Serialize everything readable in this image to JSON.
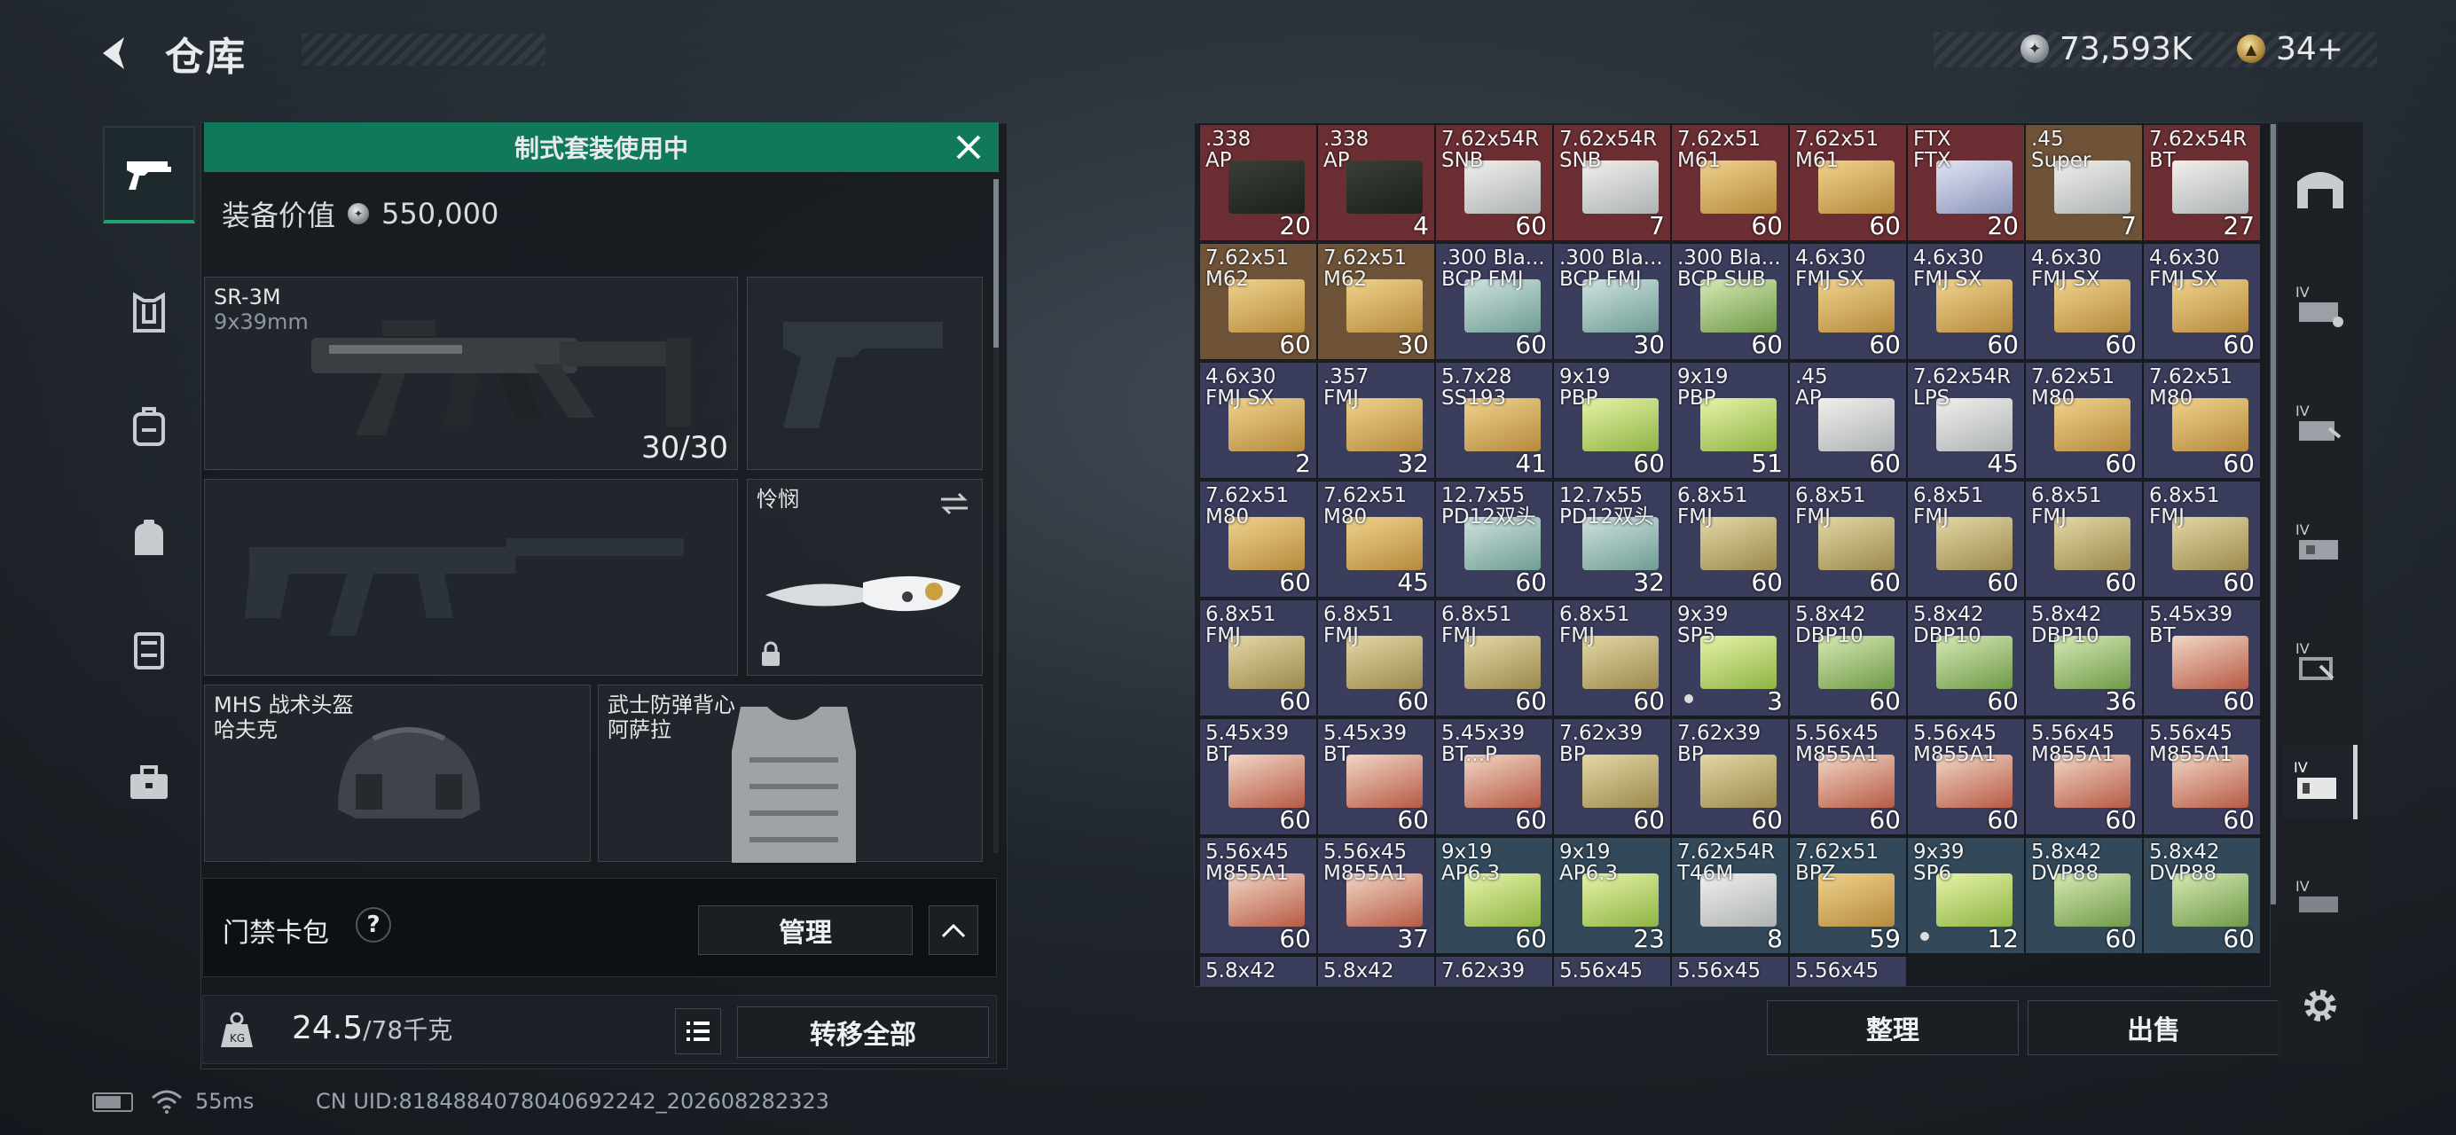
{
  "header": {
    "title": "仓库",
    "currency": "73,593K",
    "premium": "34+"
  },
  "left_nav": {
    "items": [
      "weapon-icon",
      "armor-icon",
      "backpack-icon",
      "bag-icon",
      "card-icon",
      "briefcase-icon"
    ]
  },
  "loadout": {
    "banner": "制式套装使用中",
    "value_label": "装备价值",
    "value": "550,000",
    "primary": {
      "name": "SR-3M",
      "caliber": "9x39mm",
      "ammo": "30/30"
    },
    "melee": {
      "name": "怜悯"
    },
    "helmet": {
      "name": "MHS 战术头盔",
      "sub": "哈夫克"
    },
    "vest": {
      "name": "武士防弹背心",
      "sub": "阿萨拉"
    }
  },
  "keycard": {
    "label": "门禁卡包",
    "help": "?",
    "manage": "管理"
  },
  "weight": {
    "current": "24.5",
    "max": "/78千克",
    "transfer_all": "转移全部"
  },
  "inventory": {
    "rows": [
      [
        {
          "n1": ".338",
          "n2": "AP",
          "q": "20",
          "c": "#6b2e33",
          "b": "dark"
        },
        {
          "n1": ".338",
          "n2": "AP",
          "q": "4",
          "c": "#6b2e33",
          "b": "dark"
        },
        {
          "n1": "7.62x54R",
          "n2": "SNB",
          "q": "60",
          "c": "#6b2e33",
          "b": "white"
        },
        {
          "n1": "7.62x54R",
          "n2": "SNB",
          "q": "7",
          "c": "#6b2e33",
          "b": "white"
        },
        {
          "n1": "7.62x51",
          "n2": "M61",
          "q": "60",
          "c": "#6b2e33",
          "b": "gold"
        },
        {
          "n1": "7.62x51",
          "n2": "M61",
          "q": "60",
          "c": "#6b2e33",
          "b": "gold"
        },
        {
          "n1": "FTX",
          "n2": "FTX",
          "q": "20",
          "c": "#6b2e33",
          "b": "blue"
        },
        {
          "n1": ".45",
          "n2": "Super",
          "q": "7",
          "c": "#6e5338",
          "b": "white"
        },
        {
          "n1": "7.62x54R",
          "n2": "BT",
          "q": "27",
          "c": "#6b2e33",
          "b": "white"
        }
      ],
      [
        {
          "n1": "7.62x51",
          "n2": "M62",
          "q": "60",
          "c": "#6e5338",
          "b": "gold"
        },
        {
          "n1": "7.62x51",
          "n2": "M62",
          "q": "30",
          "c": "#6e5338",
          "b": "gold"
        },
        {
          "n1": ".300 Bla...",
          "n2": "BCP FMJ",
          "q": "60",
          "c": "#3b3d5c",
          "b": "teal"
        },
        {
          "n1": ".300 Bla...",
          "n2": "BCP FMJ",
          "q": "30",
          "c": "#3b3d5c",
          "b": "teal"
        },
        {
          "n1": ".300 Bla...",
          "n2": "BCP SUB",
          "q": "60",
          "c": "#3b3d5c",
          "b": "green"
        },
        {
          "n1": "4.6x30",
          "n2": "FMJ SX",
          "q": "60",
          "c": "#3b3d5c",
          "b": "gold"
        },
        {
          "n1": "4.6x30",
          "n2": "FMJ SX",
          "q": "60",
          "c": "#3b3d5c",
          "b": "gold"
        },
        {
          "n1": "4.6x30",
          "n2": "FMJ SX",
          "q": "60",
          "c": "#3b3d5c",
          "b": "gold"
        },
        {
          "n1": "4.6x30",
          "n2": "FMJ SX",
          "q": "60",
          "c": "#3b3d5c",
          "b": "gold"
        }
      ],
      [
        {
          "n1": "4.6x30",
          "n2": "FMJ SX",
          "q": "2",
          "c": "#3b3d5c",
          "b": "gold"
        },
        {
          "n1": ".357",
          "n2": "FMJ",
          "q": "32",
          "c": "#3b3d5c",
          "b": "gold"
        },
        {
          "n1": "5.7x28",
          "n2": "SS193",
          "q": "41",
          "c": "#3b3d5c",
          "b": "gold"
        },
        {
          "n1": "9x19",
          "n2": "PBP",
          "q": "60",
          "c": "#3b3d5c",
          "b": "lime"
        },
        {
          "n1": "9x19",
          "n2": "PBP",
          "q": "51",
          "c": "#3b3d5c",
          "b": "lime"
        },
        {
          "n1": ".45",
          "n2": "AP",
          "q": "60",
          "c": "#3b3d5c",
          "b": "white"
        },
        {
          "n1": "7.62x54R",
          "n2": "LPS",
          "q": "45",
          "c": "#3b3d5c",
          "b": "white"
        },
        {
          "n1": "7.62x51",
          "n2": "M80",
          "q": "60",
          "c": "#3b3d5c",
          "b": "gold"
        },
        {
          "n1": "7.62x51",
          "n2": "M80",
          "q": "60",
          "c": "#3b3d5c",
          "b": "gold"
        }
      ],
      [
        {
          "n1": "7.62x51",
          "n2": "M80",
          "q": "60",
          "c": "#3b3d5c",
          "b": "gold"
        },
        {
          "n1": "7.62x51",
          "n2": "M80",
          "q": "45",
          "c": "#3b3d5c",
          "b": "gold"
        },
        {
          "n1": "12.7x55",
          "n2": "PD12双头",
          "q": "60",
          "c": "#3b3d5c",
          "b": "teal"
        },
        {
          "n1": "12.7x55",
          "n2": "PD12双头",
          "q": "32",
          "c": "#3b3d5c",
          "b": "teal"
        },
        {
          "n1": "6.8x51",
          "n2": "FMJ",
          "q": "60",
          "c": "#3b3d5c",
          "b": "khaki"
        },
        {
          "n1": "6.8x51",
          "n2": "FMJ",
          "q": "60",
          "c": "#3b3d5c",
          "b": "khaki"
        },
        {
          "n1": "6.8x51",
          "n2": "FMJ",
          "q": "60",
          "c": "#3b3d5c",
          "b": "khaki"
        },
        {
          "n1": "6.8x51",
          "n2": "FMJ",
          "q": "60",
          "c": "#3b3d5c",
          "b": "khaki"
        },
        {
          "n1": "6.8x51",
          "n2": "FMJ",
          "q": "60",
          "c": "#3b3d5c",
          "b": "khaki"
        }
      ],
      [
        {
          "n1": "6.8x51",
          "n2": "FMJ",
          "q": "60",
          "c": "#3b3d5c",
          "b": "khaki"
        },
        {
          "n1": "6.8x51",
          "n2": "FMJ",
          "q": "60",
          "c": "#3b3d5c",
          "b": "khaki"
        },
        {
          "n1": "6.8x51",
          "n2": "FMJ",
          "q": "60",
          "c": "#3b3d5c",
          "b": "khaki"
        },
        {
          "n1": "6.8x51",
          "n2": "FMJ",
          "q": "60",
          "c": "#3b3d5c",
          "b": "khaki"
        },
        {
          "n1": "9x39",
          "n2": "SP5",
          "q": "3",
          "c": "#3b3d5c",
          "b": "lime",
          "dot": true
        },
        {
          "n1": "5.8x42",
          "n2": "DBP10",
          "q": "60",
          "c": "#3b3d5c",
          "b": "green"
        },
        {
          "n1": "5.8x42",
          "n2": "DBP10",
          "q": "60",
          "c": "#3b3d5c",
          "b": "green"
        },
        {
          "n1": "5.8x42",
          "n2": "DBP10",
          "q": "36",
          "c": "#3b3d5c",
          "b": "green"
        },
        {
          "n1": "5.45x39",
          "n2": "BT",
          "q": "60",
          "c": "#3b3d5c",
          "b": "red"
        }
      ],
      [
        {
          "n1": "5.45x39",
          "n2": "BT",
          "q": "60",
          "c": "#3b3d5c",
          "b": "red"
        },
        {
          "n1": "5.45x39",
          "n2": "BT",
          "q": "60",
          "c": "#3b3d5c",
          "b": "red"
        },
        {
          "n1": "5.45x39",
          "n2": "BT...P",
          "q": "60",
          "c": "#3b3d5c",
          "b": "red"
        },
        {
          "n1": "7.62x39",
          "n2": "BP",
          "q": "60",
          "c": "#3b3d5c",
          "b": "khaki"
        },
        {
          "n1": "7.62x39",
          "n2": "BP",
          "q": "60",
          "c": "#3b3d5c",
          "b": "khaki"
        },
        {
          "n1": "5.56x45",
          "n2": "M855A1",
          "q": "60",
          "c": "#3b3d5c",
          "b": "red"
        },
        {
          "n1": "5.56x45",
          "n2": "M855A1",
          "q": "60",
          "c": "#3b3d5c",
          "b": "red"
        },
        {
          "n1": "5.56x45",
          "n2": "M855A1",
          "q": "60",
          "c": "#3b3d5c",
          "b": "red"
        },
        {
          "n1": "5.56x45",
          "n2": "M855A1",
          "q": "60",
          "c": "#3b3d5c",
          "b": "red"
        }
      ],
      [
        {
          "n1": "5.56x45",
          "n2": "M855A1",
          "q": "60",
          "c": "#3b3d5c",
          "b": "red"
        },
        {
          "n1": "5.56x45",
          "n2": "M855A1",
          "q": "37",
          "c": "#3b3d5c",
          "b": "red"
        },
        {
          "n1": "9x19",
          "n2": "AP6.3",
          "q": "60",
          "c": "#33495a",
          "b": "lime"
        },
        {
          "n1": "9x19",
          "n2": "AP6.3",
          "q": "23",
          "c": "#33495a",
          "b": "lime"
        },
        {
          "n1": "7.62x54R",
          "n2": "T46M",
          "q": "8",
          "c": "#33495a",
          "b": "white"
        },
        {
          "n1": "7.62x51",
          "n2": "BPZ",
          "q": "59",
          "c": "#33495a",
          "b": "gold"
        },
        {
          "n1": "9x39",
          "n2": "SP6",
          "q": "12",
          "c": "#33495a",
          "b": "lime",
          "dot": true
        },
        {
          "n1": "5.8x42",
          "n2": "DVP88",
          "q": "60",
          "c": "#33495a",
          "b": "green"
        },
        {
          "n1": "5.8x42",
          "n2": "DVP88",
          "q": "60",
          "c": "#33495a",
          "b": "green"
        }
      ],
      [
        {
          "n1": "5.8x42",
          "n2": "",
          "q": "",
          "c": "#3b3d5c",
          "b": "none"
        },
        {
          "n1": "5.8x42",
          "n2": "",
          "q": "",
          "c": "#3b3d5c",
          "b": "none"
        },
        {
          "n1": "7.62x39",
          "n2": "",
          "q": "",
          "c": "#3b3d5c",
          "b": "none"
        },
        {
          "n1": "5.56x45",
          "n2": "",
          "q": "",
          "c": "#3b3d5c",
          "b": "none"
        },
        {
          "n1": "5.56x45",
          "n2": "",
          "q": "",
          "c": "#3b3d5c",
          "b": "none"
        },
        {
          "n1": "5.56x45",
          "n2": "",
          "q": "",
          "c": "#3b3d5c",
          "b": "none"
        }
      ]
    ],
    "sort": "整理",
    "sell": "出售"
  },
  "status": {
    "ping": "55ms",
    "uid": "CN UID:8184884078040692242_202608282323"
  }
}
